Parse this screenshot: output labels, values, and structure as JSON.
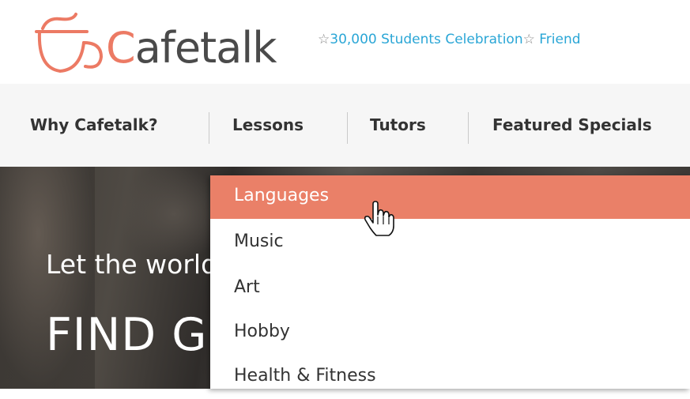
{
  "brand": {
    "logo_text_first": "C",
    "logo_text_rest": "afetalk",
    "accent_color": "#ec7a64",
    "promo_text": "30,000 Students Celebration",
    "promo_trailing": "Friend",
    "promo_star_icon": "☆"
  },
  "nav": {
    "items": [
      {
        "label": "Why Cafetalk?"
      },
      {
        "label": "Lessons"
      },
      {
        "label": "Tutors"
      },
      {
        "label": "Featured Specials"
      }
    ]
  },
  "hero": {
    "subtitle": "Let the world spice up your life",
    "title": "FIND GREAT LESSONS IN"
  },
  "dropdown": {
    "active_color": "#ea8068",
    "items": [
      {
        "label": "Languages",
        "active": true
      },
      {
        "label": "Music"
      },
      {
        "label": "Art"
      },
      {
        "label": "Hobby"
      },
      {
        "label": "Health & Fitness"
      }
    ]
  },
  "cursor": {
    "icon": "hand-pointer-icon"
  }
}
